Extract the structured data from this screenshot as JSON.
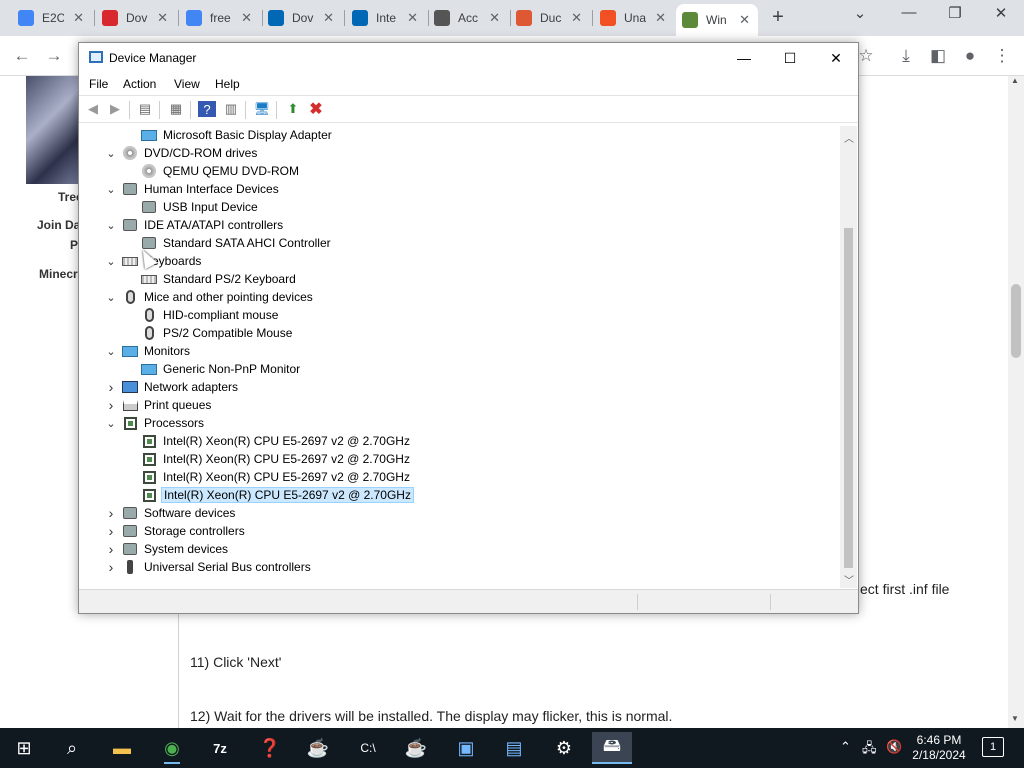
{
  "browser": {
    "tabs": [
      {
        "title": "E2C",
        "favicon": "google-icon",
        "color": "#4285f4"
      },
      {
        "title": "Dov",
        "favicon": "mega-icon",
        "color": "#d9272e"
      },
      {
        "title": "free",
        "favicon": "google-icon",
        "color": "#4285f4"
      },
      {
        "title": "Dov",
        "favicon": "intel-icon",
        "color": "#0068b5"
      },
      {
        "title": "Inte",
        "favicon": "intel-icon",
        "color": "#0068b5"
      },
      {
        "title": "Acc",
        "favicon": "network-icon",
        "color": "#555555"
      },
      {
        "title": "Duc",
        "favicon": "duckduckgo-icon",
        "color": "#de5833"
      },
      {
        "title": "Una",
        "favicon": "microsoft-icon",
        "color": "#f25022"
      },
      {
        "title": "Win",
        "favicon": "minecraft-icon",
        "color": "#5d8a3a"
      }
    ],
    "new_tab": "+"
  },
  "page": {
    "sidebar": [
      "Tree",
      "Join Da",
      "P",
      "Minecr"
    ],
    "content": [
      "ect first .inf file",
      "11) Click 'Next'",
      "12) Wait for the drivers will be installed. The display may flicker, this is normal."
    ]
  },
  "device_manager": {
    "title": "Device Manager",
    "menu": [
      "File",
      "Action",
      "View",
      "Help"
    ],
    "tree": [
      {
        "label": "Microsoft Basic Display Adapter",
        "level": 1,
        "icon": "monitor"
      },
      {
        "label": "DVD/CD-ROM drives",
        "level": 0,
        "icon": "disc",
        "expanded": true
      },
      {
        "label": "QEMU QEMU DVD-ROM",
        "level": 1,
        "icon": "disc"
      },
      {
        "label": "Human Interface Devices",
        "level": 0,
        "icon": "generic",
        "expanded": true
      },
      {
        "label": "USB Input Device",
        "level": 1,
        "icon": "generic"
      },
      {
        "label": "IDE ATA/ATAPI controllers",
        "level": 0,
        "icon": "generic",
        "expanded": true
      },
      {
        "label": "Standard SATA AHCI Controller",
        "level": 1,
        "icon": "generic"
      },
      {
        "label": "Keyboards",
        "level": 0,
        "icon": "keyboard",
        "expanded": true
      },
      {
        "label": "Standard PS/2 Keyboard",
        "level": 1,
        "icon": "keyboard"
      },
      {
        "label": "Mice and other pointing devices",
        "level": 0,
        "icon": "mouse",
        "expanded": true
      },
      {
        "label": "HID-compliant mouse",
        "level": 1,
        "icon": "mouse"
      },
      {
        "label": "PS/2 Compatible Mouse",
        "level": 1,
        "icon": "mouse"
      },
      {
        "label": "Monitors",
        "level": 0,
        "icon": "monitor",
        "expanded": true
      },
      {
        "label": "Generic Non-PnP Monitor",
        "level": 1,
        "icon": "monitor"
      },
      {
        "label": "Network adapters",
        "level": 0,
        "icon": "network",
        "expanded": false
      },
      {
        "label": "Print queues",
        "level": 0,
        "icon": "printer",
        "expanded": false
      },
      {
        "label": "Processors",
        "level": 0,
        "icon": "chip",
        "expanded": true
      },
      {
        "label": "Intel(R) Xeon(R) CPU E5-2697 v2 @ 2.70GHz",
        "level": 1,
        "icon": "chip"
      },
      {
        "label": "Intel(R) Xeon(R) CPU E5-2697 v2 @ 2.70GHz",
        "level": 1,
        "icon": "chip"
      },
      {
        "label": "Intel(R) Xeon(R) CPU E5-2697 v2 @ 2.70GHz",
        "level": 1,
        "icon": "chip"
      },
      {
        "label": "Intel(R) Xeon(R) CPU E5-2697 v2 @ 2.70GHz",
        "level": 1,
        "icon": "chip",
        "selected": true
      },
      {
        "label": "Software devices",
        "level": 0,
        "icon": "generic",
        "expanded": false
      },
      {
        "label": "Storage controllers",
        "level": 0,
        "icon": "generic",
        "expanded": false
      },
      {
        "label": "System devices",
        "level": 0,
        "icon": "generic",
        "expanded": false
      },
      {
        "label": "Universal Serial Bus controllers",
        "level": 0,
        "icon": "usb",
        "expanded": false
      }
    ]
  },
  "taskbar": {
    "time": "6:46 PM",
    "date": "2/18/2024",
    "notifications": "1"
  },
  "colors": {
    "selection": "#cce8ff",
    "taskbar": "#101820",
    "uninstall_red": "#d32f2f"
  }
}
